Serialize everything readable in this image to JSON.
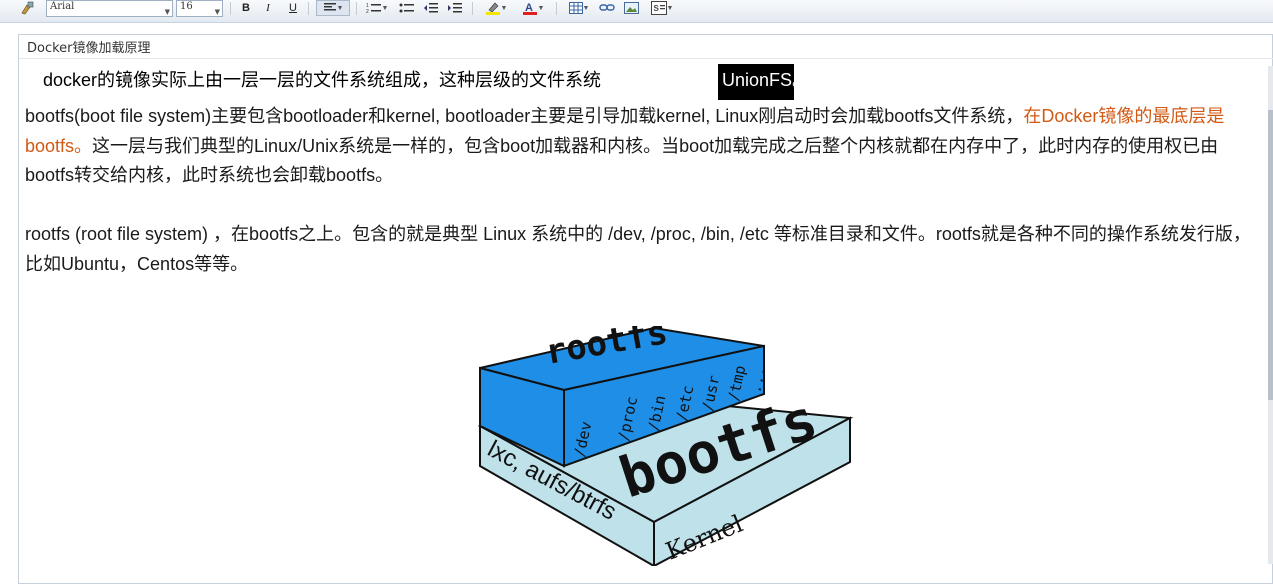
{
  "toolbar": {
    "font_name": "Arial",
    "font_size": "16",
    "bold": "B",
    "italic": "I",
    "underline": "U"
  },
  "document": {
    "title": "Docker镜像加载原理",
    "line1_prefix": "docker的镜像实际上由一层一层的文件系统组成，这种层级的文件系统",
    "line1_highlight": "UnionFS。",
    "para1_a": "bootfs(boot file system)主要包含bootloader和kernel, bootloader主要是引导加载kernel, Linux刚启动时会加载bootfs文件系统，",
    "para1_red": "在Docker镜像的最底层是bootfs。",
    "para1_b": "这一层与我们典型的Linux/Unix系统是一样的，包含boot加载器和内核。当boot加载完成之后整个内核就都在内存中了，此时内存的使用权已由bootfs转交给内核，此时系统也会卸载bootfs。",
    "para2": "rootfs (root file system) ，在bootfs之上。包含的就是典型 Linux 系统中的 /dev, /proc, /bin, /etc 等标准目录和文件。rootfs就是各种不同的操作系统发行版，比如Ubuntu，Centos等等。"
  },
  "figure": {
    "top_label": "rootfs",
    "dirs": [
      "/dev",
      "/proc",
      "/bin",
      "/etc",
      "/usr",
      "/tmp",
      "..."
    ],
    "bottom_label": "bootfs",
    "side_label": "lxc, aufs/btrfs",
    "kernel_label": "Kernel"
  },
  "colors": {
    "red_text": "#d25a14",
    "rootfs_blue": "#1f8ee6",
    "bootfs_light": "#bfe2ea"
  }
}
